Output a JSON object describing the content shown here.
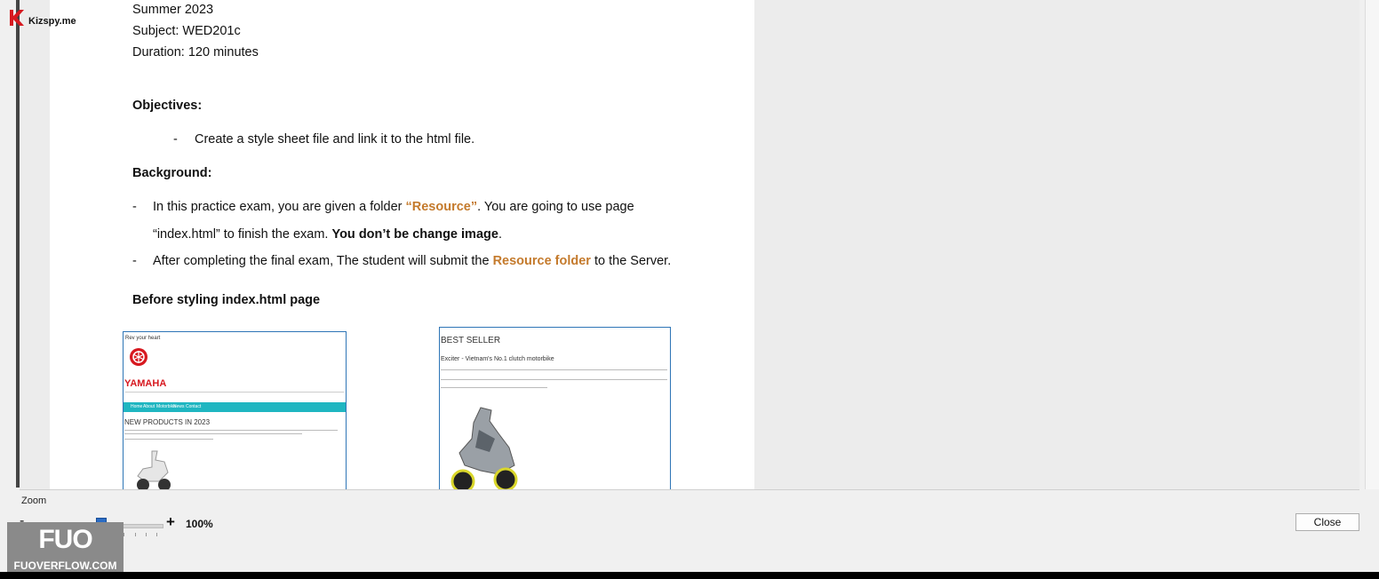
{
  "watermark": {
    "brand": "Kizspy.me",
    "fuo_logo": "FUO",
    "fuo_site": "FUOVERFLOW.COM"
  },
  "document": {
    "term": "Summer 2023",
    "subject": "Subject: WED201c",
    "duration": "Duration: 120 minutes",
    "objectives_heading": "Objectives:",
    "objective_bullet": "-",
    "objective_1": "Create a style sheet file and link it to the html file.",
    "background_heading": "Background:",
    "bg_bullet_1": "-",
    "bg_p1_a": "In this practice exam, you are given a folder ",
    "bg_p1_resource": "“Resource”",
    "bg_p1_b": ". You are going to use page",
    "bg_p1_c": "“index.html”  to finish the exam. ",
    "bg_p1_bold": "You don’t be change image",
    "bg_p1_end": ".",
    "bg_bullet_2": "-",
    "bg_p2_a": "After completing the final exam, The student will submit the ",
    "bg_p2_folder": "Resource folder",
    "bg_p2_b": " to the Server.",
    "before_heading": "Before styling index.html page"
  },
  "screenshot_left": {
    "top_text": "Rev your heart",
    "brand": "YAMAHA",
    "nav": [
      "Home",
      "About",
      "Motorbike",
      "News",
      "Contact"
    ],
    "section_title": "NEW PRODUCTS IN 2023"
  },
  "screenshot_right": {
    "title": "BEST SELLER",
    "subtitle": "Exciter - Vietnam's No.1 clutch motorbike"
  },
  "controls": {
    "zoom_label": "Zoom",
    "zoom_minus": "-",
    "zoom_plus": "+",
    "zoom_value": "100%",
    "close_label": "Close"
  },
  "colors": {
    "accent_orange": "#c47a2c",
    "teal_nav": "#1fb6c1",
    "yamaha_red": "#d71920",
    "slider_blue": "#2b6cc4"
  }
}
